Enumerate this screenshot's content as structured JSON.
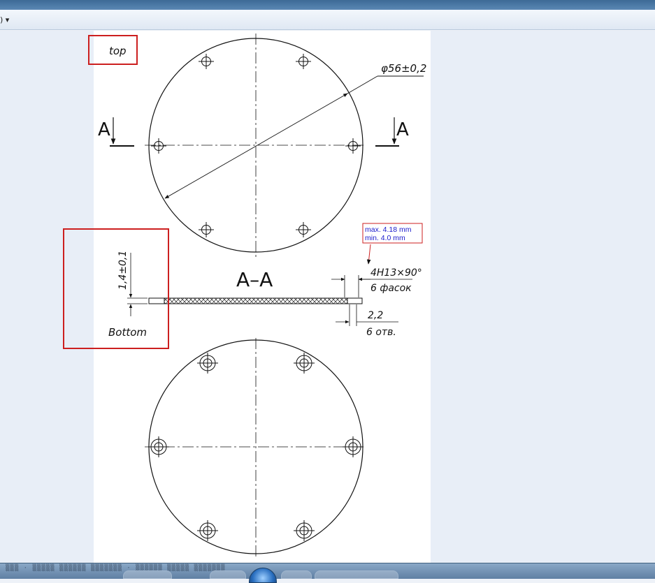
{
  "toolbar": {
    "dropdown_label": ") ▾"
  },
  "drawing": {
    "labels": {
      "top": "top",
      "bottom": "Bottom",
      "section_left": "A",
      "section_right": "A",
      "section_title": "A–A",
      "diameter": "φ56±0,2",
      "thickness": "1,4±0,1",
      "chamfer_spec": "4H13×90°",
      "chamfer_count": "6 фасок",
      "hole_diameter": "2,2",
      "hole_count": "6 отв."
    },
    "measurement": {
      "max": "max. 4.18 mm",
      "min": "min. 4.0 mm"
    },
    "colors": {
      "highlight_box": "#cc1f1f",
      "measurement_text": "#1a1acc",
      "ink": "#111111"
    }
  },
  "taskbar": {
    "text": "▒▒▒ · ▒▒▒▒▒ ▒▒▒▒▒▒ ▒▒▒▒▒▒▒ · ▒▒▒▒▒▒ ▒▒▒▒▒ ▒▒▒▒▒▒▒"
  }
}
